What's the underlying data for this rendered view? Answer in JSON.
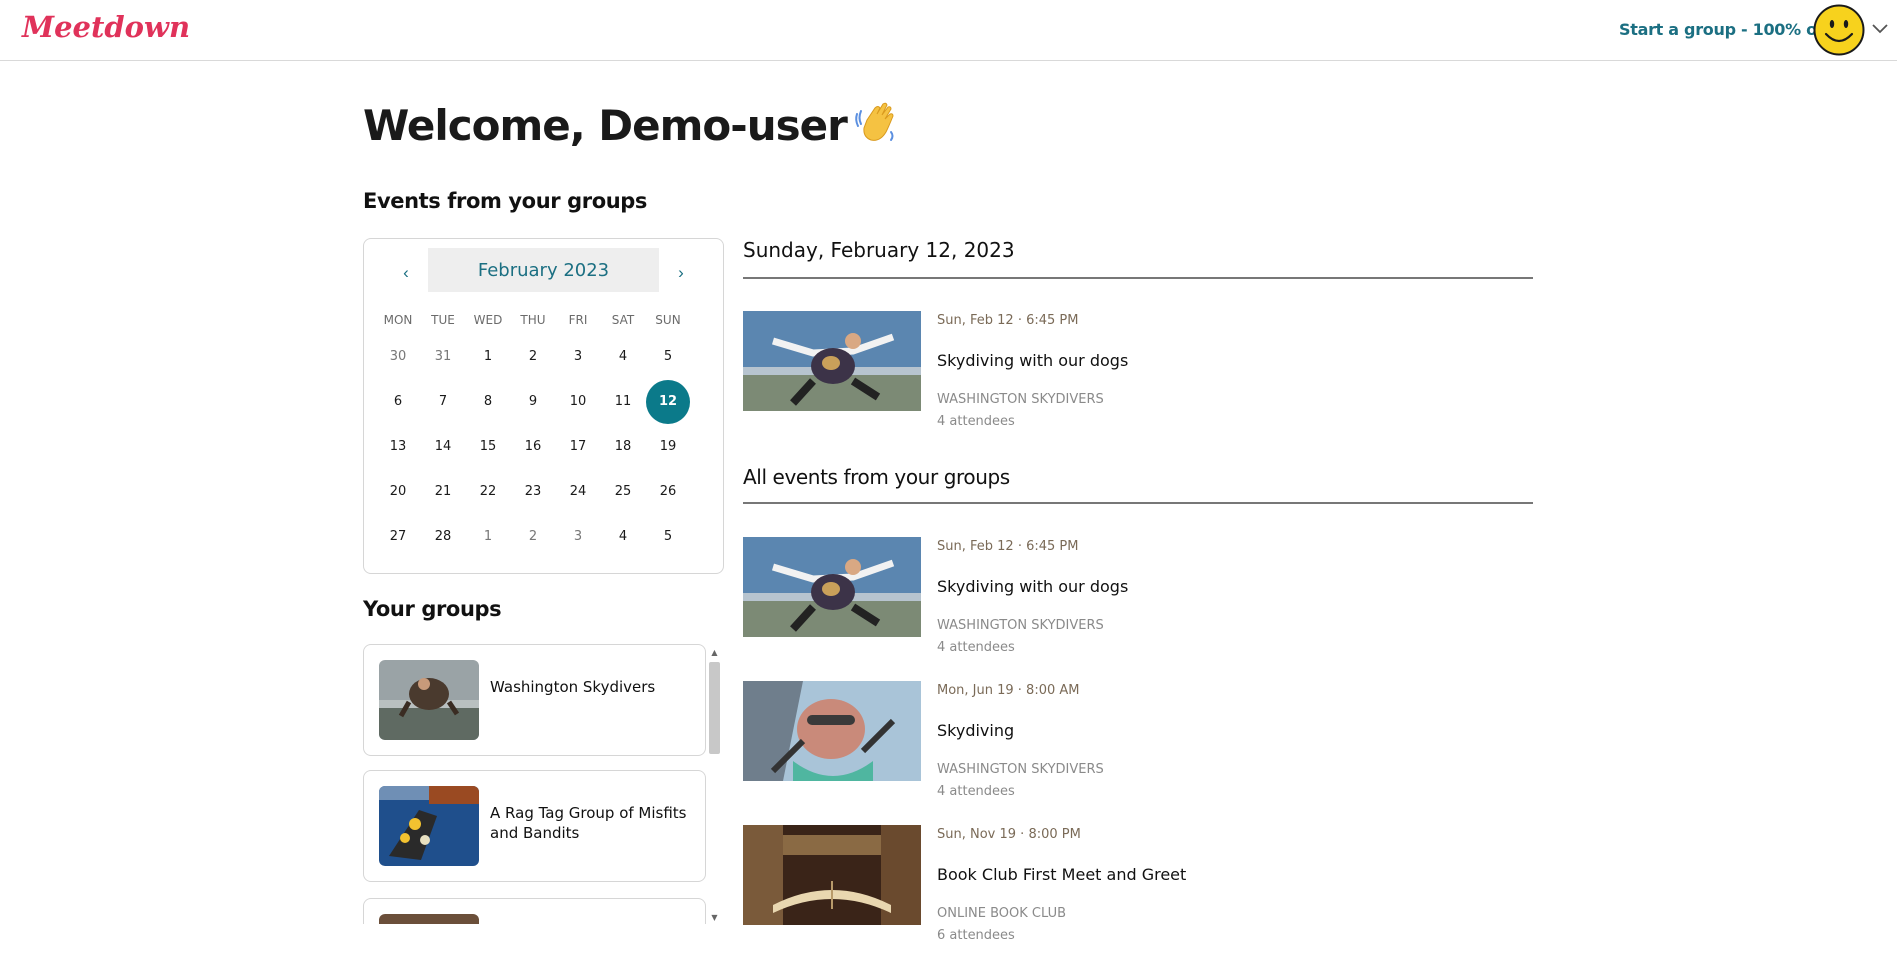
{
  "header": {
    "logo_text": "Meetdown",
    "start_group_link": "Start a group - 100% off!",
    "avatar_icon": "smiley-face-icon",
    "menu_icon": "chevron-down-icon"
  },
  "welcome": {
    "title": "Welcome, Demo-user",
    "wave_icon": "waving-hand-icon"
  },
  "sections": {
    "events_from_groups": "Events from your groups",
    "your_groups": "Your groups"
  },
  "calendar": {
    "prev_label": "‹",
    "next_label": "›",
    "month_label": "February 2023",
    "weekdays": [
      "MON",
      "TUE",
      "WED",
      "THU",
      "FRI",
      "SAT",
      "SUN"
    ],
    "weeks": [
      [
        {
          "d": "30",
          "other": true
        },
        {
          "d": "31",
          "other": true
        },
        {
          "d": "1"
        },
        {
          "d": "2"
        },
        {
          "d": "3"
        },
        {
          "d": "4"
        },
        {
          "d": "5"
        }
      ],
      [
        {
          "d": "6"
        },
        {
          "d": "7"
        },
        {
          "d": "8"
        },
        {
          "d": "9"
        },
        {
          "d": "10"
        },
        {
          "d": "11"
        },
        {
          "d": "12",
          "selected": true
        }
      ],
      [
        {
          "d": "13"
        },
        {
          "d": "14"
        },
        {
          "d": "15"
        },
        {
          "d": "16"
        },
        {
          "d": "17"
        },
        {
          "d": "18"
        },
        {
          "d": "19"
        }
      ],
      [
        {
          "d": "20"
        },
        {
          "d": "21"
        },
        {
          "d": "22"
        },
        {
          "d": "23"
        },
        {
          "d": "24"
        },
        {
          "d": "25"
        },
        {
          "d": "26"
        }
      ],
      [
        {
          "d": "27"
        },
        {
          "d": "28"
        },
        {
          "d": "1",
          "other": true
        },
        {
          "d": "2",
          "other": true
        },
        {
          "d": "3",
          "other": true
        },
        {
          "d": "4"
        },
        {
          "d": "5"
        }
      ]
    ],
    "selected_color": "#0b7a8a"
  },
  "groups": [
    {
      "name": "Washington Skydivers",
      "image": "skydiver-photo"
    },
    {
      "name": "A Rag Tag Group of Misfits and Bandits",
      "image": "boat-photo"
    },
    {
      "name": "",
      "image": "partial-photo"
    }
  ],
  "selected_day": {
    "header": "Sunday, February 12, 2023",
    "events": [
      {
        "date": "Sun, Feb 12 · 6:45 PM",
        "title": "Skydiving with our dogs",
        "group": "WASHINGTON SKYDIVERS",
        "attendees": "4 attendees",
        "image": "skydiving-dog-photo"
      }
    ]
  },
  "all_events": {
    "header": "All events from your groups",
    "events": [
      {
        "date": "Sun, Feb 12 · 6:45 PM",
        "title": "Skydiving with our dogs",
        "group": "WASHINGTON SKYDIVERS",
        "attendees": "4 attendees",
        "image": "skydiving-dog-photo"
      },
      {
        "date": "Mon, Jun 19 · 8:00 AM",
        "title": "Skydiving",
        "group": "WASHINGTON SKYDIVERS",
        "attendees": "4 attendees",
        "image": "skydiving-face-photo"
      },
      {
        "date": "Sun, Nov 19 · 8:00 PM",
        "title": "Book Club First Meet and Greet",
        "group": "ONLINE BOOK CLUB",
        "attendees": "6 attendees",
        "image": "books-photo"
      }
    ]
  },
  "colors": {
    "brand": "#e0325a",
    "link": "#1b6f82",
    "date_text": "#7a6a57",
    "muted_text": "#8a8a8a"
  }
}
